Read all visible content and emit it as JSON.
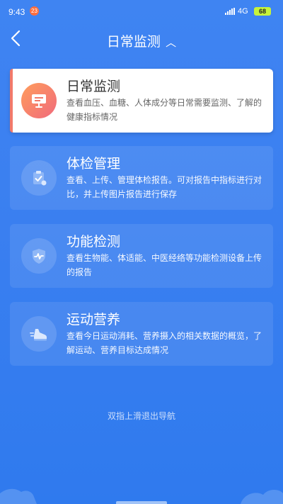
{
  "status_bar": {
    "time": "9:43",
    "notification_badge": "23",
    "network": "4G",
    "battery": "68"
  },
  "header": {
    "title": "日常监测",
    "title_caret": "︿"
  },
  "cards": [
    {
      "title": "日常监测",
      "desc": "查看血压、血糖、人体成分等日常需要监测、了解的健康指标情况",
      "icon": "monitor-screen-icon",
      "active": true
    },
    {
      "title": "体检管理",
      "desc": "查看、上传、管理体检报告。可对报告中指标进行对比，并上传图片报告进行保存",
      "icon": "clipboard-check-icon",
      "active": false
    },
    {
      "title": "功能检测",
      "desc": "查看生物能、体适能、中医经络等功能检测设备上传的报告",
      "icon": "shield-pulse-icon",
      "active": false
    },
    {
      "title": "运动营养",
      "desc": "查看今日运动消耗、营养摄入的相关数据的概览，了解运动、营养目标达成情况",
      "icon": "running-shoe-icon",
      "active": false
    }
  ],
  "hint": "双指上滑退出导航",
  "colors": {
    "background": "#3a7ff0",
    "accent_active": "#f27a6a"
  }
}
